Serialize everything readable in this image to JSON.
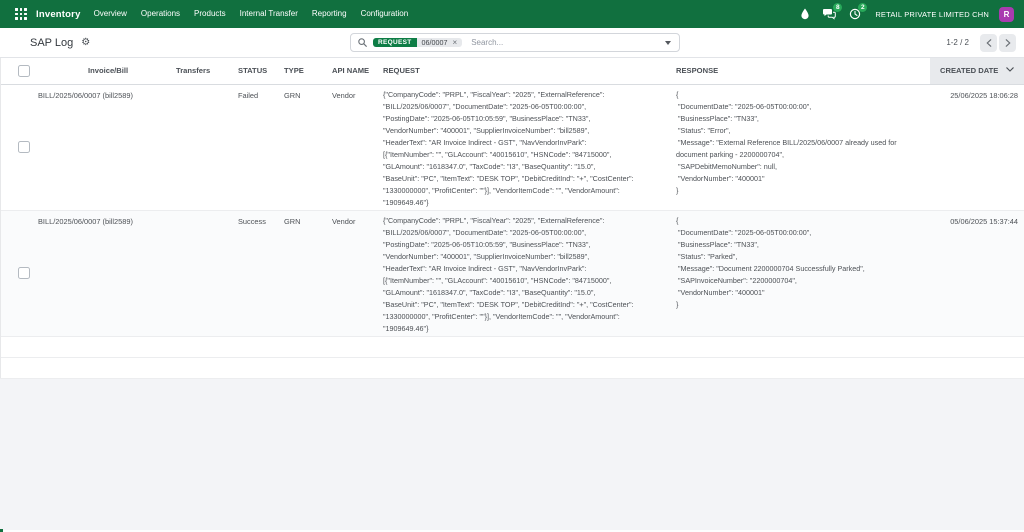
{
  "navbar": {
    "app_name": "Inventory",
    "menus": [
      "Overview",
      "Operations",
      "Products",
      "Internal Transfer",
      "Reporting",
      "Configuration"
    ],
    "icons": {
      "apps_grid": "apps-grid-icon",
      "droplet": "droplet-icon",
      "messages": {
        "name": "messages-icon",
        "badge": "8"
      },
      "activities": {
        "name": "activity-clock-icon",
        "badge": "2"
      }
    },
    "company_name": "RETAIL PRIVATE LIMITED CHN",
    "user_avatar_initial": "R"
  },
  "control_panel": {
    "title": "SAP Log",
    "settings_icon": "gear-icon",
    "search": {
      "facet": {
        "label": "REQUEST",
        "value": "06/0007"
      },
      "placeholder": "Search..."
    },
    "pager": {
      "text": "1-2 / 2"
    }
  },
  "table": {
    "headers": {
      "invoice_bill": "Invoice/Bill",
      "transfers": "Transfers",
      "status": "STATUS",
      "type": "TYPE",
      "api_name": "API NAME",
      "request": "REQUEST",
      "response": "RESPONSE",
      "created_date": "CREATED DATE"
    },
    "sort": {
      "column": "created_date",
      "direction": "desc"
    },
    "rows": [
      {
        "invoice_bill": "BILL/2025/06/0007 (bill2589)",
        "transfers": "",
        "status": "Failed",
        "type": "GRN",
        "api_name": "Vendor",
        "request": "{\"CompanyCode\": \"PRPL\", \"FiscalYear\": \"2025\", \"ExternalReference\":\n\"BILL/2025/06/0007\", \"DocumentDate\": \"2025-06-05T00:00:00\",\n\"PostingDate\": \"2025-06-05T10:05:59\", \"BusinessPlace\": \"TN33\",\n\"VendorNumber\": \"400001\", \"SupplierInvoiceNumber\": \"bill2589\",\n\"HeaderText\": \"AR Invoice Indirect - GST\", \"NavVendorInvPark\":\n[{\"ItemNumber\": \"\", \"GLAccount\": \"40015610\", \"HSNCode\": \"84715000\",\n\"GLAmount\": \"1618347.0\", \"TaxCode\": \"I3\", \"BaseQuantity\": \"15.0\",\n\"BaseUnit\": \"PC\", \"ItemText\": \"DESK TOP\", \"DebitCreditInd\": \"+\", \"CostCenter\":\n\"1330000000\", \"ProfitCenter\": \"\"}], \"VendorItemCode\": \"\", \"VendorAmount\":\n\"1909649.46\"}",
        "response": "{\n \"DocumentDate\": \"2025-06-05T00:00:00\",\n \"BusinessPlace\": \"TN33\",\n \"Status\": \"Error\",\n \"Message\": \"External Reference BILL/2025/06/0007 already used for\ndocument parking - 2200000704\",\n \"SAPDebitMemoNumber\": null,\n \"VendorNumber\": \"400001\"\n}",
        "created_date": "25/06/2025 18:06:28"
      },
      {
        "invoice_bill": "BILL/2025/06/0007 (bill2589)",
        "transfers": "",
        "status": "Success",
        "type": "GRN",
        "api_name": "Vendor",
        "request": "{\"CompanyCode\": \"PRPL\", \"FiscalYear\": \"2025\", \"ExternalReference\":\n\"BILL/2025/06/0007\", \"DocumentDate\": \"2025-06-05T00:00:00\",\n\"PostingDate\": \"2025-06-05T10:05:59\", \"BusinessPlace\": \"TN33\",\n\"VendorNumber\": \"400001\", \"SupplierInvoiceNumber\": \"bill2589\",\n\"HeaderText\": \"AR Invoice Indirect - GST\", \"NavVendorInvPark\":\n[{\"ItemNumber\": \"\", \"GLAccount\": \"40015610\", \"HSNCode\": \"84715000\",\n\"GLAmount\": \"1618347.0\", \"TaxCode\": \"I3\", \"BaseQuantity\": \"15.0\",\n\"BaseUnit\": \"PC\", \"ItemText\": \"DESK TOP\", \"DebitCreditInd\": \"+\", \"CostCenter\":\n\"1330000000\", \"ProfitCenter\": \"\"}], \"VendorItemCode\": \"\", \"VendorAmount\":\n\"1909649.46\"}",
        "response": "{\n \"DocumentDate\": \"2025-06-05T00:00:00\",\n \"BusinessPlace\": \"TN33\",\n \"Status\": \"Parked\",\n \"Message\": \"Document 2200000704 Successfully Parked\",\n \"SAPInvoiceNumber\": \"2200000704\",\n \"VendorNumber\": \"400001\"\n}",
        "created_date": "05/06/2025 15:37:44"
      }
    ]
  },
  "colors": {
    "navbar_bg": "#11703f",
    "facet_label_bg": "#0e7d46",
    "badge_green": "#28a95a",
    "avatar_bg": "#a93bb0",
    "page_bg": "#f3f4f7",
    "sorted_header_bg": "#e8eaed"
  }
}
